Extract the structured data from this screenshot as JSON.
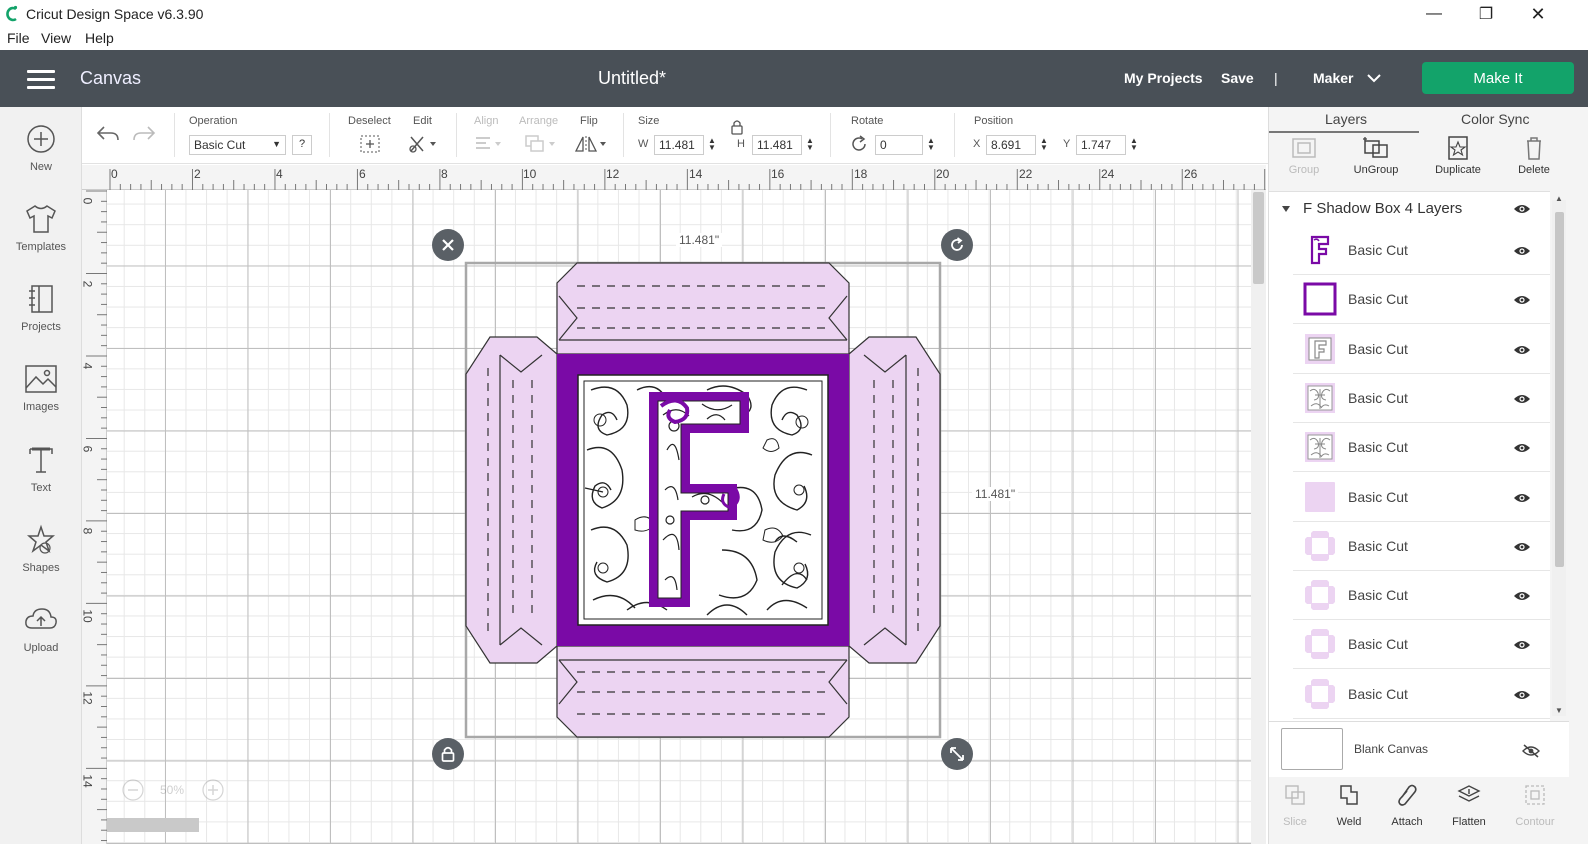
{
  "window": {
    "title": "Cricut Design Space  v6.3.90",
    "minimize": "—",
    "restore": "❐",
    "close": "✕"
  },
  "menu": [
    "File",
    "View",
    "Help"
  ],
  "header": {
    "canvas_label": "Canvas",
    "doc_title": "Untitled*",
    "my_projects": "My Projects",
    "save": "Save",
    "divider": "|",
    "machine": "Maker",
    "make_it": "Make It"
  },
  "toolbar": {
    "operation_label": "Operation",
    "operation_value": "Basic Cut",
    "help": "?",
    "deselect_label": "Deselect",
    "edit_label": "Edit",
    "align_label": "Align",
    "arrange_label": "Arrange",
    "flip_label": "Flip",
    "size_label": "Size",
    "w_label": "W",
    "w_value": "11.481",
    "h_label": "H",
    "h_value": "11.481",
    "rotate_label": "Rotate",
    "rotate_value": "0",
    "position_label": "Position",
    "x_label": "X",
    "x_value": "8.691",
    "y_label": "Y",
    "y_value": "1.747"
  },
  "sidebar": [
    {
      "label": "New",
      "icon": "plus-circle-icon"
    },
    {
      "label": "Templates",
      "icon": "tshirt-icon"
    },
    {
      "label": "Projects",
      "icon": "projects-icon"
    },
    {
      "label": "Images",
      "icon": "image-icon"
    },
    {
      "label": "Text",
      "icon": "text-icon"
    },
    {
      "label": "Shapes",
      "icon": "shapes-icon"
    },
    {
      "label": "Upload",
      "icon": "cloud-upload-icon"
    }
  ],
  "ruler": {
    "h": [
      "0",
      "2",
      "4",
      "6",
      "8",
      "10",
      "12",
      "14",
      "16",
      "18",
      "20",
      "22",
      "24",
      "26"
    ],
    "v": [
      "0",
      "2",
      "4",
      "6",
      "8",
      "10",
      "12",
      "14"
    ]
  },
  "canvas": {
    "width_dim": "11.481\"",
    "height_dim": "11.481\"",
    "zoom": "50%"
  },
  "panel": {
    "tab_layers": "Layers",
    "tab_colorsync": "Color Sync",
    "tools": {
      "group": "Group",
      "ungroup": "UnGroup",
      "duplicate": "Duplicate",
      "delete": "Delete"
    },
    "group_name": "F Shadow Box 4 Layers",
    "layers": [
      {
        "name": "Basic Cut",
        "thumb": "letter-f"
      },
      {
        "name": "Basic Cut",
        "thumb": "square-outline"
      },
      {
        "name": "Basic Cut",
        "thumb": "frame-f"
      },
      {
        "name": "Basic Cut",
        "thumb": "filigree"
      },
      {
        "name": "Basic Cut",
        "thumb": "filigree"
      },
      {
        "name": "Basic Cut",
        "thumb": "solid-square"
      },
      {
        "name": "Basic Cut",
        "thumb": "box"
      },
      {
        "name": "Basic Cut",
        "thumb": "box"
      },
      {
        "name": "Basic Cut",
        "thumb": "box"
      },
      {
        "name": "Basic Cut",
        "thumb": "box"
      }
    ],
    "blank_canvas": "Blank Canvas",
    "bottom_tools": {
      "slice": "Slice",
      "weld": "Weld",
      "attach": "Attach",
      "flatten": "Flatten",
      "contour": "Contour"
    }
  },
  "colors": {
    "header": "#495057",
    "make_it": "#13a36a",
    "purple": "#7a0aa6",
    "lavender": "#ecd4f2"
  }
}
